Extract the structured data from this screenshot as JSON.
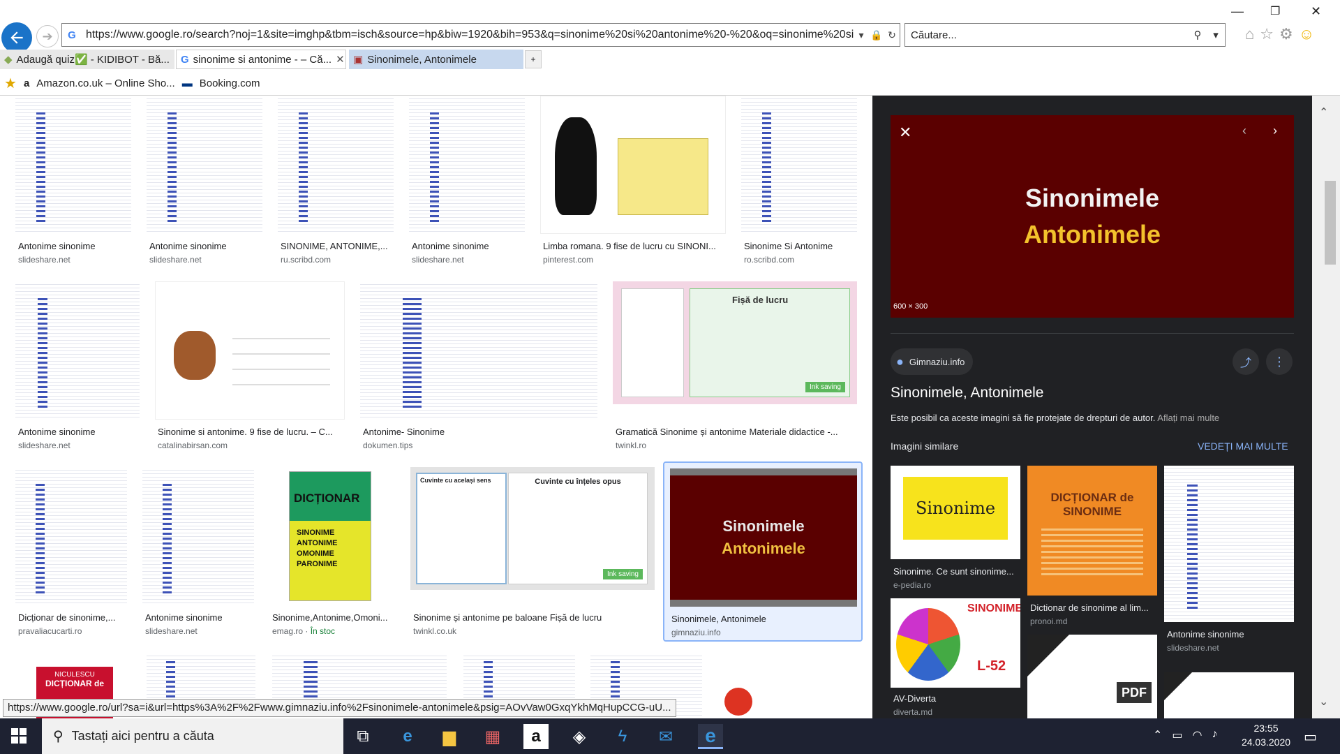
{
  "browser": {
    "address_url": "https://www.google.ro/search?noj=1&site=imghp&tbm=isch&source=hp&biw=1920&bih=953&q=sinonime%20si%20antonime%20-%20&oq=sinonime%20si%20a",
    "search_placeholder": "Căutare...",
    "tabs": [
      {
        "label": "Adaugă quiz✅ - KIDIBOT - Bă..."
      },
      {
        "label": "sinonime si antonime - – Că..."
      },
      {
        "label": "Sinonimele, Antonimele"
      }
    ],
    "favorites": [
      {
        "label": "Amazon.co.uk – Online Sho..."
      },
      {
        "label": "Booking.com"
      }
    ]
  },
  "results": [
    {
      "title": "Antonime sinonime",
      "source": "slideshare.net"
    },
    {
      "title": "Antonime sinonime",
      "source": "slideshare.net"
    },
    {
      "title": "SINONIME, ANTONIME,...",
      "source": "ru.scribd.com"
    },
    {
      "title": "Antonime sinonime",
      "source": "slideshare.net"
    },
    {
      "title": "Limba romana. 9 fise de lucru cu SINONI...",
      "source": "pinterest.com"
    },
    {
      "title": "Sinonime Si Antonime",
      "source": "ro.scribd.com"
    },
    {
      "title": "Antonime sinonime",
      "source": "slideshare.net"
    },
    {
      "title": "Sinonime si antonime. 9 fise de lucru. – C...",
      "source": "catalinabirsan.com"
    },
    {
      "title": "Antonime- Sinonime",
      "source": "dokumen.tips"
    },
    {
      "title": "Gramatică Sinonime și antonime Materiale didactice -...",
      "source": "twinkl.ro"
    },
    {
      "title": "Dicționar de sinonime,...",
      "source": "pravaliacucarti.ro"
    },
    {
      "title": "Antonime sinonime",
      "source": "slideshare.net"
    },
    {
      "title": "Sinonime,Antonime,Omoni...",
      "source": "emag.ro",
      "extra": "În stoc"
    },
    {
      "title": "Sinonime și antonime pe baloane Fișă de lucru",
      "source": "twinkl.co.uk"
    },
    {
      "title": "Sinonimele, Antonimele",
      "source": "gimnaziu.info"
    }
  ],
  "thumb_text": {
    "dictionar": "DICȚIONAR",
    "book_words": [
      "SINONIME",
      "ANTONIME",
      "OMONIME",
      "PARONIME"
    ],
    "sinonimele": "Sinonimele",
    "antonimele": "Antonimele",
    "fisa": "Fișă de lucru",
    "cuvinte1": "Cuvinte cu același sens",
    "cuvinte2": "Cuvinte cu înțeles opus",
    "ink_saving": "Ink saving",
    "niculescu": "NICULESCU",
    "dict_de": "DICȚIONAR de"
  },
  "panel": {
    "preview_title1": "Sinonimele",
    "preview_title2": "Antonimele",
    "dimensions": "600 × 300",
    "site_badge": "Gimnaziu.info",
    "title": "Sinonimele, Antonimele",
    "copyright": "Este posibil ca aceste imagini să fie protejate de drepturi de autor.",
    "learn_more": "Aflați mai multe",
    "similar_heading": "Imagini similare",
    "see_more": "VEDEȚI MAI MULTE",
    "similar": [
      {
        "title": "Sinonime. Ce sunt sinonime...",
        "source": "e-pedia.ro",
        "img_text": "Sinonime"
      },
      {
        "title": "Dictionar de sinonime al lim...",
        "source": "pronoi.md",
        "img_text": "DICȚIONAR de SINONIME"
      },
      {
        "title": "Antonime sinonime",
        "source": "slideshare.net"
      },
      {
        "title": "AV-Diverta",
        "source": "diverta.md",
        "img_text": "SINONIME",
        "img_sub": "L-52"
      },
      {
        "title": "",
        "source": "",
        "img_text": "PDF"
      }
    ]
  },
  "status_url": "https://www.google.ro/url?sa=i&url=https%3A%2F%2Fwww.gimnaziu.info%2Fsinonimele-antonimele&psig=AOvVaw0GxqYkhMqHupCCG-uU...",
  "taskbar": {
    "search_placeholder": "Tastați aici pentru a căuta",
    "time": "23:55",
    "date": "24.03.2020"
  },
  "colors": {
    "panel_bg": "#202124",
    "accent_blue": "#8ab4f8",
    "preview_dark_red": "#5a0000",
    "taskbar_bg": "#1e2232"
  }
}
